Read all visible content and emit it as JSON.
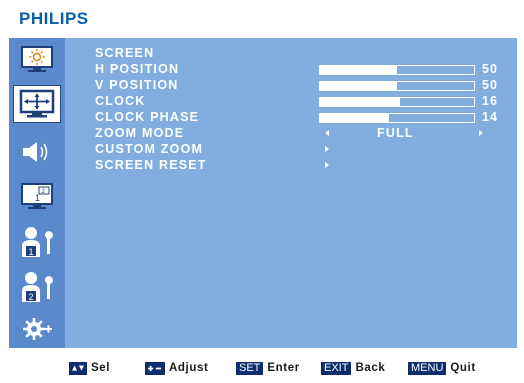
{
  "brand": {
    "logo_text": "PHILIPS",
    "color": "#0b5ea8"
  },
  "osd": {
    "background": "#81aede",
    "sidebar_background": "#5a89cc"
  },
  "sidebar": {
    "items": [
      {
        "id": "picture",
        "icon": "brightness-monitor-icon",
        "active": false
      },
      {
        "id": "screen",
        "icon": "screen-position-icon",
        "active": true
      },
      {
        "id": "audio",
        "icon": "speaker-icon",
        "active": false
      },
      {
        "id": "pip",
        "icon": "pip-monitor-icon",
        "pip_label_main": "1",
        "pip_label_sub": "2",
        "active": false
      },
      {
        "id": "config1",
        "icon": "user-config-icon",
        "badge": "1",
        "active": false
      },
      {
        "id": "config2",
        "icon": "user-config-icon",
        "badge": "2",
        "active": false
      },
      {
        "id": "advanced",
        "icon": "gear-plus-icon",
        "active": false
      }
    ]
  },
  "menu": {
    "title": "SCREEN",
    "items": [
      {
        "label": "H POSITION",
        "type": "slider",
        "value": "50",
        "fill_fraction": 0.5
      },
      {
        "label": "V POSITION",
        "type": "slider",
        "value": "50",
        "fill_fraction": 0.5
      },
      {
        "label": "CLOCK",
        "type": "slider",
        "value": "16",
        "fill_fraction": 0.52
      },
      {
        "label": "CLOCK PHASE",
        "type": "slider",
        "value": "14",
        "fill_fraction": 0.45
      },
      {
        "label": "ZOOM MODE",
        "type": "select",
        "value": "FULL"
      },
      {
        "label": "CUSTOM ZOOM",
        "type": "submenu"
      },
      {
        "label": "SCREEN RESET",
        "type": "submenu"
      }
    ]
  },
  "footer": {
    "sel": {
      "key_icon": "up-down-arrows-icon",
      "label": "Sel"
    },
    "adjust": {
      "key_icon": "plus-minus-icon",
      "label": "Adjust"
    },
    "enter": {
      "key": "SET",
      "label": "Enter"
    },
    "back": {
      "key": "EXIT",
      "label": "Back"
    },
    "quit": {
      "key": "MENU",
      "label": "Quit"
    }
  }
}
